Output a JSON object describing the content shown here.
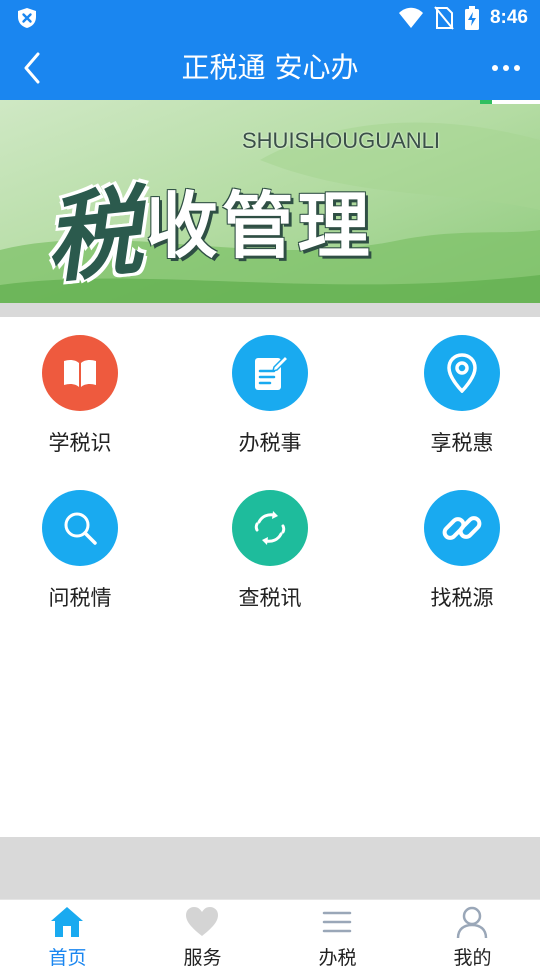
{
  "status_bar": {
    "time": "8:46",
    "icons": [
      "shield-x-icon",
      "wifi-icon",
      "no-sim-icon",
      "battery-charging-icon"
    ]
  },
  "app_bar": {
    "title": "正税通 安心办",
    "back_icon": "chevron-left-icon",
    "more_icon": "more-dots-icon"
  },
  "banner": {
    "subtitle": "SHUISHOUGUANLI",
    "title_first": "税",
    "title_rest": "收管理"
  },
  "grid": {
    "items": [
      {
        "label": "学税识",
        "icon": "book-icon",
        "color": "#ee5a3e"
      },
      {
        "label": "办税事",
        "icon": "form-edit-icon",
        "color": "#19aaf0"
      },
      {
        "label": "享税惠",
        "icon": "location-pin-icon",
        "color": "#19aaf0"
      },
      {
        "label": "问税情",
        "icon": "search-icon",
        "color": "#19aaf0"
      },
      {
        "label": "查税讯",
        "icon": "refresh-icon",
        "color": "#1ebc9c"
      },
      {
        "label": "找税源",
        "icon": "link-icon",
        "color": "#19aaf0"
      }
    ]
  },
  "tab_bar": {
    "tabs": [
      {
        "label": "首页",
        "icon": "home-icon",
        "active": true
      },
      {
        "label": "服务",
        "icon": "heart-icon",
        "active": false
      },
      {
        "label": "办税",
        "icon": "menu-lines-icon",
        "active": false
      },
      {
        "label": "我的",
        "icon": "user-icon",
        "active": false
      }
    ]
  },
  "colors": {
    "primary": "#1a86f0",
    "active_tab": "#1a86f0"
  }
}
